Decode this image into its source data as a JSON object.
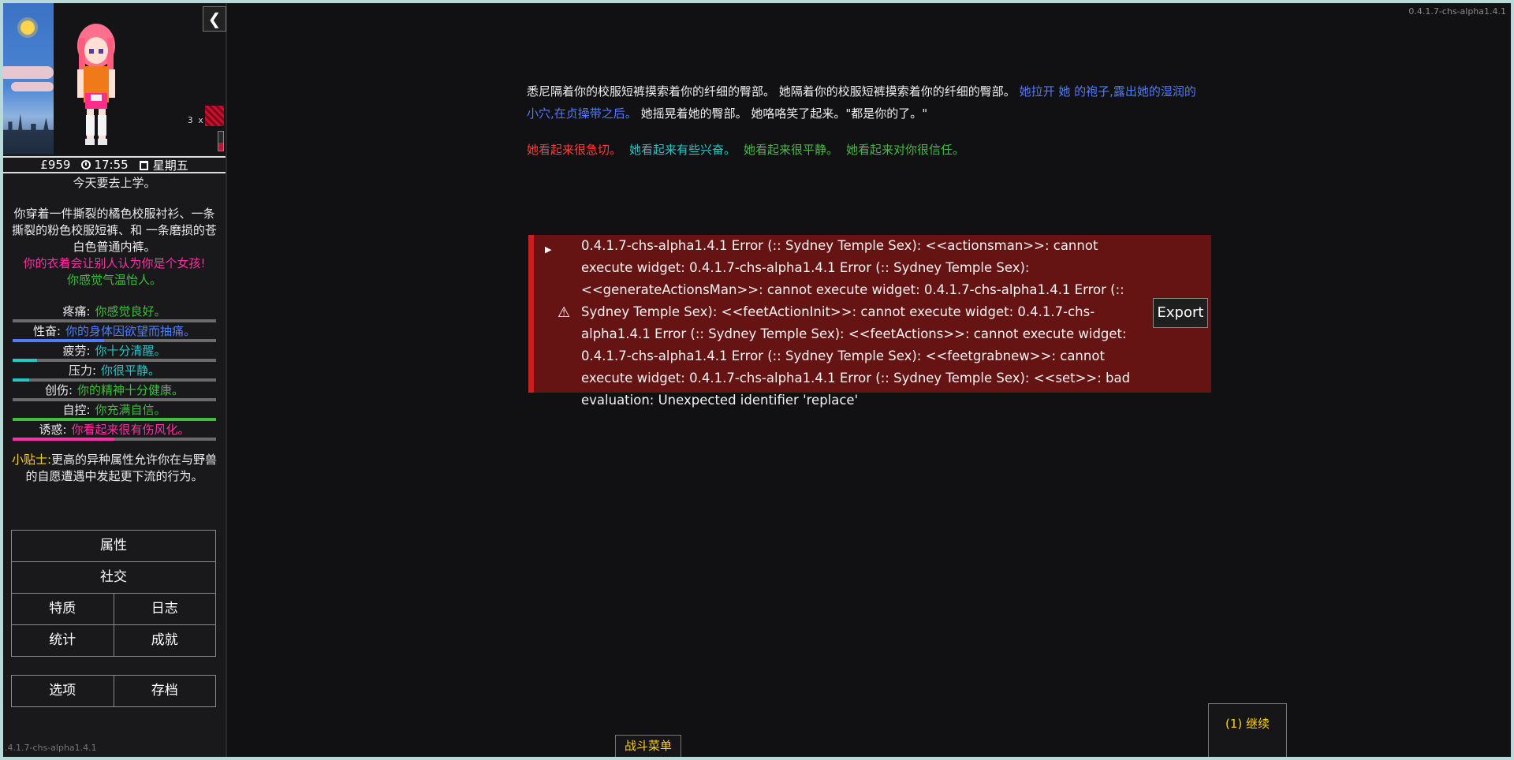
{
  "top_version": "0.4.1.7-chs-alpha1.4.1",
  "sidebar": {
    "collapse_icon": "chevron-left-icon",
    "arousal_count": "3 x",
    "status": {
      "money": "£959",
      "time": "17:55",
      "day": "星期五"
    },
    "school_note": "今天要去上学。",
    "clothing_desc": "你穿着一件撕裂的橘色校服衬衫、一条撕裂的粉色校服短裤、和 一条磨损的苍白色普通内裤。",
    "gender_note": "你的衣着会让别人认为你是个女孩!",
    "weather_note": "你感觉气温怡人。",
    "stats": [
      {
        "label": "疼痛:",
        "value": "你感觉良好。",
        "color": "#3fbf3f",
        "fill": 0.0,
        "bar_color": "#3fbf3f"
      },
      {
        "label": "性奋:",
        "value": "你的身体因欲望而抽痛。",
        "color": "#4f7cff",
        "fill": 0.45,
        "bar_color": "#4f7cff"
      },
      {
        "label": "疲劳:",
        "value": "你十分清醒。",
        "color": "#24c6c6",
        "fill": 0.12,
        "bar_color": "#24c6c6"
      },
      {
        "label": "压力:",
        "value": "你很平静。",
        "color": "#24c6c6",
        "fill": 0.08,
        "bar_color": "#24c6c6"
      },
      {
        "label": "创伤:",
        "value": "你的精神十分健康。",
        "color": "#3fbf3f",
        "fill": 0.0,
        "bar_color": "#3fbf3f"
      },
      {
        "label": "自控:",
        "value": "你充满自信。",
        "color": "#3fbf3f",
        "fill": 1.0,
        "bar_color": "#3fbf3f"
      },
      {
        "label": "诱惑:",
        "value": "你看起来很有伤风化。",
        "color": "#ff2ea6",
        "fill": 0.5,
        "bar_color": "#ff2ea6"
      }
    ],
    "tip_label": "小贴士:",
    "tip_text": "更高的异种属性允许你在与野兽的自愿遭遇中发起更下流的行为。",
    "menu": {
      "attributes": "属性",
      "social": "社交",
      "traits": "特质",
      "journal": "日志",
      "statistics": "统计",
      "achievements": "成就",
      "options": "选项",
      "saves": "存档"
    },
    "version": ".4.1.7-chs-alpha1.4.1"
  },
  "passage": {
    "p1_white": "悉尼隔着你的校服短裤摸索着你的纤细的臀部。 她隔着你的校服短裤摸索着你的纤细的臀部。",
    "p1_blue": "她拉开 她 的袍子,露出她的湿润的小穴,在贞操带之后。",
    "p1_white2": "她摇晃着她的臀部。 她咯咯笑了起来。\"都是你的了。\"",
    "moods": [
      {
        "text": "她看起来很急切。",
        "color": "#ff3b3b"
      },
      {
        "text": "她看起来有些兴奋。",
        "color": "#24c6c6"
      },
      {
        "text": "她看起来很平静。",
        "color": "#3fbf3f"
      },
      {
        "text": "她看起来对你很信任。",
        "color": "#3fbf3f"
      }
    ]
  },
  "error": {
    "toggle_icon": "triangle-right-icon",
    "warning_icon": "warning-icon",
    "message": "0.4.1.7-chs-alpha1.4.1 Error (:: Sydney Temple Sex): <<actionsman>>: cannot execute widget: 0.4.1.7-chs-alpha1.4.1 Error (:: Sydney Temple Sex): <<generateActionsMan>>: cannot execute widget: 0.4.1.7-chs-alpha1.4.1 Error (:: Sydney Temple Sex): <<feetActionInit>>: cannot execute widget: 0.4.1.7-chs-alpha1.4.1 Error (:: Sydney Temple Sex): <<feetActions>>: cannot execute widget: 0.4.1.7-chs-alpha1.4.1 Error (:: Sydney Temple Sex): <<feetgrabnew>>: cannot execute widget: 0.4.1.7-chs-alpha1.4.1 Error (:: Sydney Temple Sex): <<set>>: bad evaluation: Unexpected identifier 'replace'",
    "export_label": "Export"
  },
  "combat_menu_label": "战斗菜单",
  "continue_label": "(1) 继续"
}
